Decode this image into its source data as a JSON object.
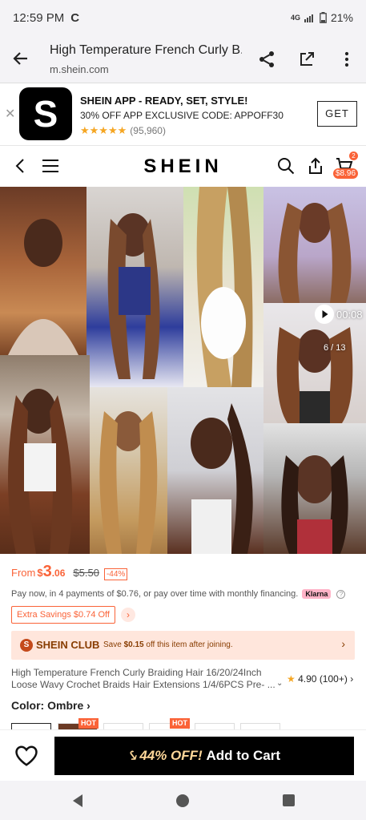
{
  "status_bar": {
    "time": "12:59 PM",
    "carrier_glyph": "C",
    "network": "4G",
    "battery": "21%"
  },
  "browser": {
    "page_title": "High Temperature French Curly B...",
    "url": "m.shein.com"
  },
  "app_banner": {
    "logo_letter": "S",
    "title": "SHEIN APP - READY, SET, STYLE!",
    "subtitle": "30% OFF APP EXCLUSIVE CODE: APPOFF30",
    "stars": "★★★★★",
    "rating_count": "(95,960)",
    "get_label": "GET"
  },
  "site_header": {
    "logo": "SHEIN",
    "cart_count": "2",
    "cart_price": "$8.96"
  },
  "gallery": {
    "video_time": "00:08",
    "counter": "6 / 13"
  },
  "price": {
    "from_label": "From",
    "currency": "$",
    "whole": "3",
    "fraction": ".06",
    "original": "$5.50",
    "discount": "-44%"
  },
  "installment": {
    "text": "Pay now, in 4 payments of $0.76, or pay over time with monthly financing.",
    "provider": "Klarna"
  },
  "extra_savings": "Extra Savings $0.74 Off",
  "club": {
    "name": "SHEIN CLUB",
    "desc_prefix": "Save ",
    "desc_amount": "$0.15",
    "desc_suffix": " off this item after joining."
  },
  "product": {
    "title": "High Temperature French Curly Braiding Hair 16/20/24Inch Loose Wavy Crochet Braids Hair Extensions 1/4/6PCS Pre- ...",
    "rating": "4.90",
    "rating_count": "(100+)"
  },
  "color": {
    "label": "Color:",
    "value": "Ombre"
  },
  "swatches": {
    "hot_label": "HOT"
  },
  "bottom_bar": {
    "discount_text": "44% OFF!",
    "button_label": "Add to Cart"
  },
  "colors": {
    "accent": "#fa6338",
    "brand_black": "#000000",
    "club_bg": "#ffe6dc",
    "club_text": "#873c00"
  }
}
